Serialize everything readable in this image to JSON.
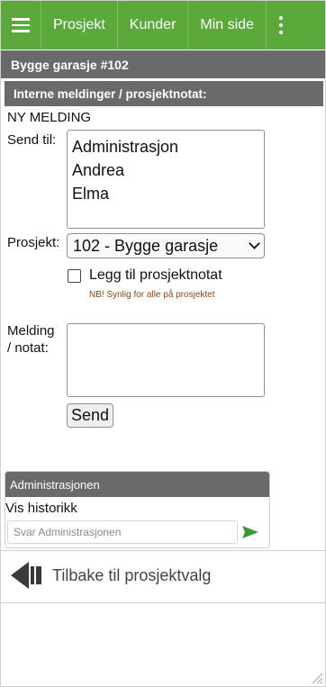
{
  "nav": {
    "items": [
      "Prosjekt",
      "Kunder",
      "Min side"
    ]
  },
  "title": "Bygge garasje #102",
  "section_title": "Interne meldinger / prosjektnotat:",
  "form": {
    "heading": "NY MELDING",
    "send_to_label": "Send til:",
    "recipients": [
      "Administrasjon",
      "Andrea",
      "Elma"
    ],
    "project_label": "Prosjekt:",
    "project_selected": "102 - Bygge garasje",
    "checkbox_label": "Legg til prosjektnotat",
    "checkbox_checked": false,
    "note": "NB! Synlig for alle på prosjektet",
    "message_label_1": "Melding",
    "message_label_2": "/ notat:",
    "message_value": "",
    "send_label": "Send"
  },
  "thread": {
    "header": "Administrasjonen",
    "history_link": "Vis historikk",
    "reply_placeholder": "Svar Administrasjonen"
  },
  "back_label": "Tilbake til prosjektvalg",
  "colors": {
    "nav_bg": "#5aa93a",
    "bar_bg": "#6a6a6a",
    "note_color": "#8b4513",
    "send_icon": "#3a9a3a"
  }
}
